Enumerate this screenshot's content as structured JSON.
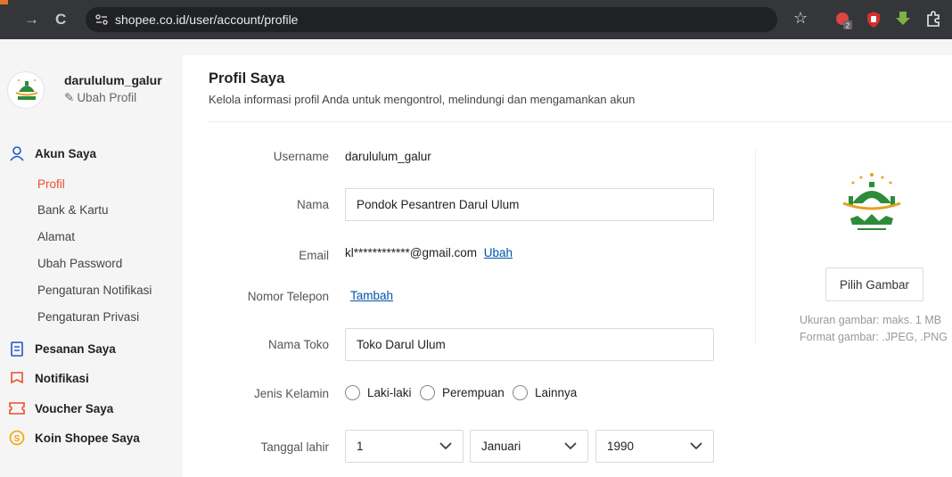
{
  "browser": {
    "url": "shopee.co.id/user/account/profile",
    "ext_badge": "2"
  },
  "sidebar": {
    "username": "darululum_galur",
    "edit_profile": "Ubah Profil",
    "sections": [
      {
        "label": "Akun Saya",
        "icon": "user-icon"
      },
      {
        "label": "Pesanan Saya",
        "icon": "clipboard-icon"
      },
      {
        "label": "Notifikasi",
        "icon": "bell-icon"
      },
      {
        "label": "Voucher Saya",
        "icon": "ticket-icon"
      },
      {
        "label": "Koin Shopee Saya",
        "icon": "coin-icon"
      }
    ],
    "account_items": [
      "Profil",
      "Bank & Kartu",
      "Alamat",
      "Ubah Password",
      "Pengaturan Notifikasi",
      "Pengaturan Privasi"
    ],
    "active_item": "Profil"
  },
  "main": {
    "title": "Profil Saya",
    "subtitle": "Kelola informasi profil Anda untuk mengontrol, melindungi dan mengamankan akun",
    "fields": {
      "username_label": "Username",
      "username_value": "darululum_galur",
      "name_label": "Nama",
      "name_value": "Pondok Pesantren Darul Ulum",
      "email_label": "Email",
      "email_value": "kl************@gmail.com",
      "email_change": "Ubah",
      "phone_label": "Nomor Telepon",
      "phone_add": "Tambah",
      "shop_label": "Nama Toko",
      "shop_value": "Toko Darul Ulum",
      "gender_label": "Jenis Kelamin",
      "gender_options": [
        "Laki-laki",
        "Perempuan",
        "Lainnya"
      ],
      "dob_label": "Tanggal lahir",
      "dob_day": "1",
      "dob_month": "Januari",
      "dob_year": "1990"
    },
    "image_panel": {
      "button": "Pilih Gambar",
      "size_hint": "Ukuran gambar: maks. 1 MB",
      "format_hint": "Format gambar: .JPEG, .PNG"
    }
  },
  "colors": {
    "accent": "#ee4d2d",
    "link": "#0055aa",
    "logo_green": "#2e8b3a",
    "logo_orange": "#e8a020"
  }
}
